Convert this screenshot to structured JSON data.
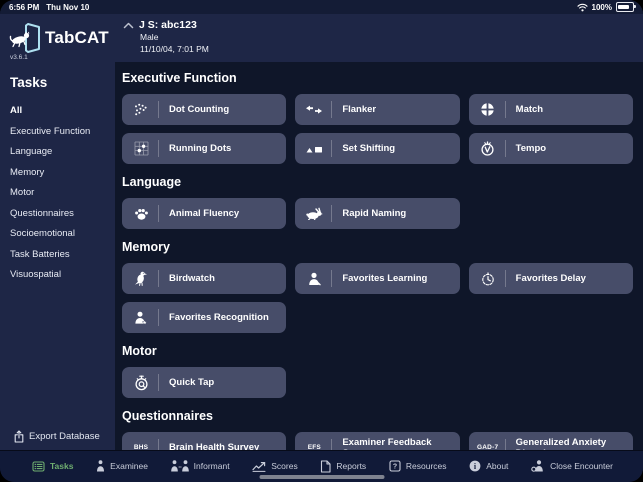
{
  "status_bar": {
    "time": "6:56 PM",
    "date": "Thu Nov 10",
    "battery_percent": "100%",
    "icons": [
      "wifi-icon",
      "battery-icon"
    ]
  },
  "branding": {
    "app_name": "TabCAT",
    "version": "v3.6.1",
    "logo_icon": "cat-through-tablet-logo"
  },
  "patient_header": {
    "name": "J S: abc123",
    "sex": "Male",
    "datetime": "11/10/04, 7:01 PM",
    "collapse_icon": "chevron-up-icon"
  },
  "sidebar": {
    "heading": "Tasks",
    "items": [
      {
        "label": "All",
        "active": true
      },
      {
        "label": "Executive Function",
        "active": false
      },
      {
        "label": "Language",
        "active": false
      },
      {
        "label": "Memory",
        "active": false
      },
      {
        "label": "Motor",
        "active": false
      },
      {
        "label": "Questionnaires",
        "active": false
      },
      {
        "label": "Socioemotional",
        "active": false
      },
      {
        "label": "Task Batteries",
        "active": false
      },
      {
        "label": "Visuospatial",
        "active": false
      }
    ],
    "export_label": "Export Database",
    "export_icon": "share-export-icon"
  },
  "sections": [
    {
      "title": "Executive Function",
      "tasks": [
        {
          "label": "Dot Counting",
          "icon": "dot-counting-icon"
        },
        {
          "label": "Flanker",
          "icon": "flanker-arrows-icon"
        },
        {
          "label": "Match",
          "icon": "match-quadrant-circle-icon"
        },
        {
          "label": "Running Dots",
          "icon": "running-dots-grid-icon"
        },
        {
          "label": "Set Shifting",
          "icon": "set-shifting-shapes-icon"
        },
        {
          "label": "Tempo",
          "icon": "tempo-metronome-icon"
        }
      ]
    },
    {
      "title": "Language",
      "tasks": [
        {
          "label": "Animal Fluency",
          "icon": "paw-icon"
        },
        {
          "label": "Rapid Naming",
          "icon": "rabbit-icon"
        }
      ]
    },
    {
      "title": "Memory",
      "tasks": [
        {
          "label": "Birdwatch",
          "icon": "bird-icon"
        },
        {
          "label": "Favorites Learning",
          "icon": "person-icon"
        },
        {
          "label": "Favorites Delay",
          "icon": "timer-icon"
        },
        {
          "label": "Favorites Recognition",
          "icon": "person-star-icon"
        }
      ]
    },
    {
      "title": "Motor",
      "tasks": [
        {
          "label": "Quick Tap",
          "icon": "stopwatch-q-icon"
        }
      ]
    },
    {
      "title": "Questionnaires",
      "tasks": [
        {
          "label": "Brain Health Survey",
          "icon": "bhs-text-icon",
          "icon_text": "BHS"
        },
        {
          "label": "Examiner Feedback Survey",
          "icon": "efs-text-icon",
          "icon_text": "EFS"
        },
        {
          "label": "Generalized Anxiety Disorder",
          "icon": "gad7-text-icon",
          "icon_text": "GAD-7"
        }
      ]
    }
  ],
  "tab_bar": {
    "items": [
      {
        "label": "Tasks",
        "icon": "tasks-list-icon",
        "active": true
      },
      {
        "label": "Examinee",
        "icon": "examinee-person-icon",
        "active": false
      },
      {
        "label": "Informant",
        "icon": "informant-people-icon",
        "active": false
      },
      {
        "label": "Scores",
        "icon": "scores-chart-icon",
        "active": false
      },
      {
        "label": "Reports",
        "icon": "reports-document-icon",
        "active": false
      },
      {
        "label": "Resources",
        "icon": "resources-question-icon",
        "active": false
      },
      {
        "label": "About",
        "icon": "about-info-icon",
        "active": false
      },
      {
        "label": "Close Encounter",
        "icon": "close-encounter-person-icon",
        "active": false
      }
    ]
  },
  "colors": {
    "background": "#0f1629",
    "panel": "#1e2646",
    "button": "#474d69",
    "status_bar": "#141c36",
    "tab_bar": "#111a38",
    "accent_green": "#6fae70",
    "text": "#ffffff"
  }
}
